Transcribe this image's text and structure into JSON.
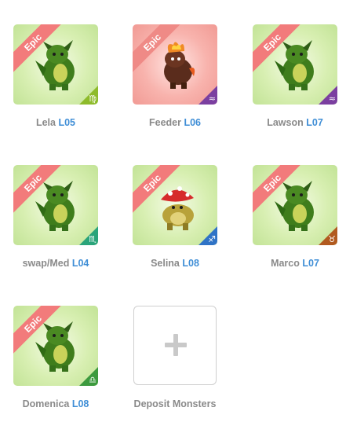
{
  "monsters": [
    {
      "ribbon": "Epic",
      "name": "Lela",
      "level": "L05",
      "bg": "green",
      "badge_color": "#8ebb2b",
      "badge_icon": "virgo-icon",
      "badge_glyph": "♍"
    },
    {
      "ribbon": "Epic",
      "name": "Feeder",
      "level": "L06",
      "bg": "pink",
      "badge_color": "#7b3fa0",
      "badge_icon": "aquarius-icon",
      "badge_glyph": "≈"
    },
    {
      "ribbon": "Epic",
      "name": "Lawson",
      "level": "L07",
      "bg": "green",
      "badge_color": "#7b3fa0",
      "badge_icon": "aquarius-icon",
      "badge_glyph": "≈"
    },
    {
      "ribbon": "Epic",
      "name": "swap/Med",
      "level": "L04",
      "bg": "green",
      "badge_color": "#2aa47a",
      "badge_icon": "scorpio-icon",
      "badge_glyph": "♏"
    },
    {
      "ribbon": "Epic",
      "name": "Selina",
      "level": "L08",
      "bg": "green",
      "badge_color": "#2f73c6",
      "badge_icon": "sagittarius-icon",
      "badge_glyph": "♐"
    },
    {
      "ribbon": "Epic",
      "name": "Marco",
      "level": "L07",
      "bg": "green",
      "badge_color": "#b15a1f",
      "badge_icon": "taurus-icon",
      "badge_glyph": "♉"
    },
    {
      "ribbon": "Epic",
      "name": "Domenica",
      "level": "L08",
      "bg": "green",
      "badge_color": "#3c9a3e",
      "badge_icon": "libra-icon",
      "badge_glyph": "♎"
    }
  ],
  "deposit": {
    "label": "Deposit Monsters",
    "icon": "plus-icon"
  }
}
